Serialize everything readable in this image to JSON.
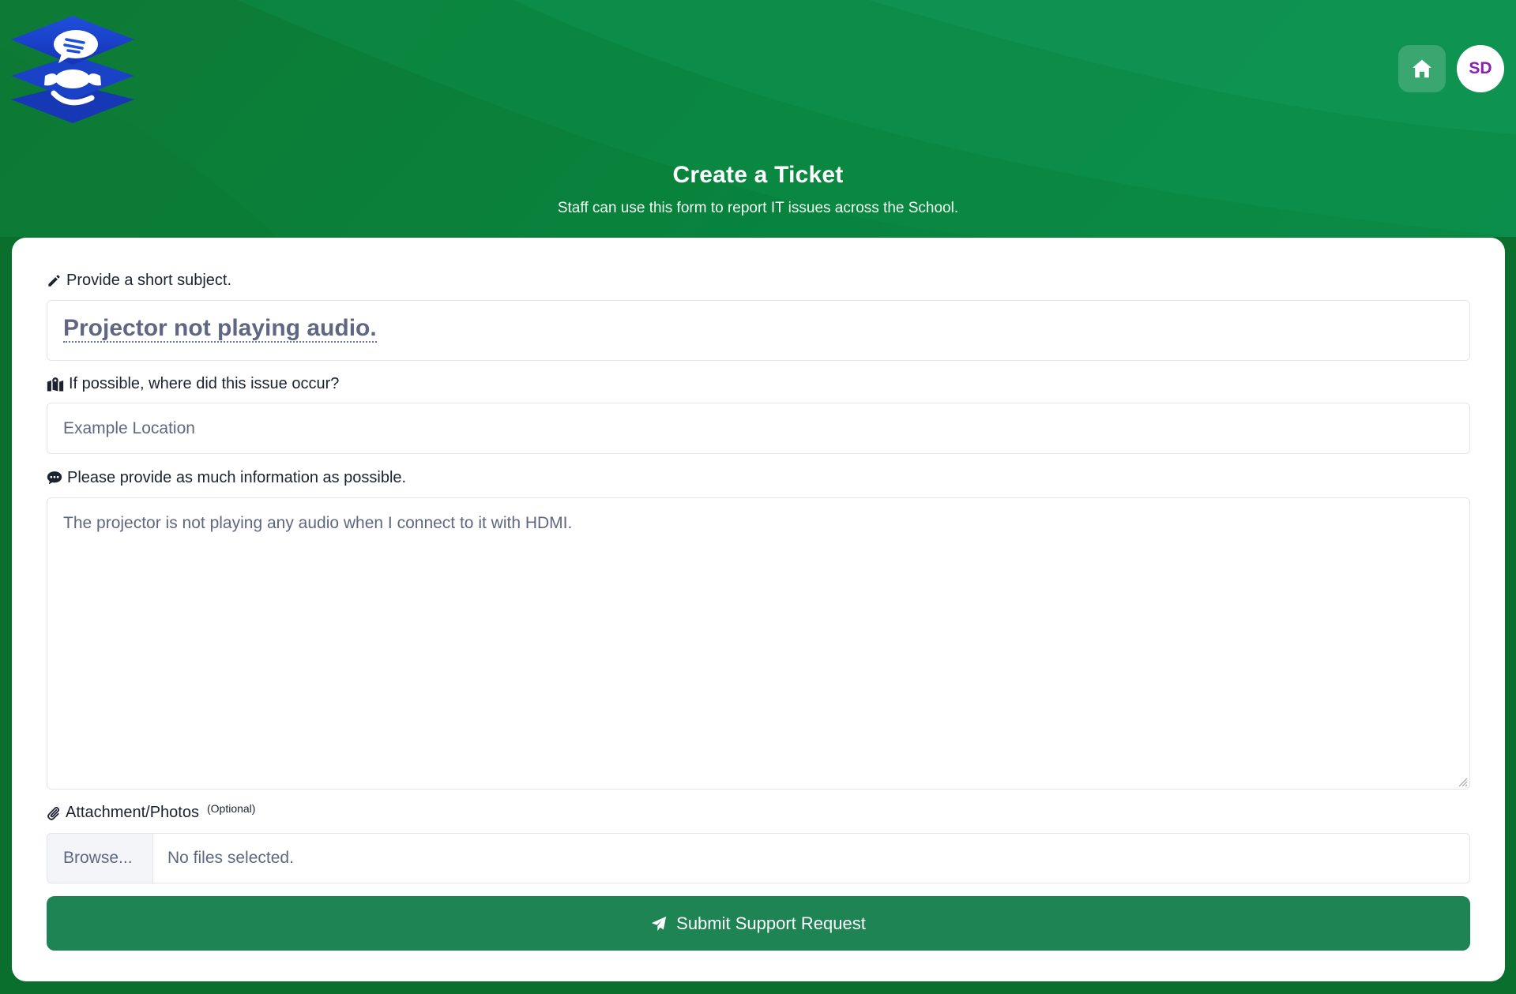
{
  "brand": {
    "bg_color": "#0a7a3a",
    "accent": "#1e8454",
    "avatar_text_color": "#8b1fb0"
  },
  "nav": {
    "home_icon": "home-icon",
    "avatar_initials": "SD"
  },
  "header": {
    "title": "Create a Ticket",
    "subtitle": "Staff can use this form to report IT issues across the School."
  },
  "form": {
    "subject": {
      "label": "Provide a short subject.",
      "icon": "pencil-icon",
      "value": "Projector not playing audio."
    },
    "location": {
      "label": "If possible, where did this issue occur?",
      "icon": "map-icon",
      "placeholder": "Example Location"
    },
    "description": {
      "label": "Please provide as much information as possible.",
      "icon": "comment-icon",
      "value": "The projector is not playing any audio when I connect to it with HDMI."
    },
    "attachment": {
      "label": "Attachment/Photos",
      "optional": "(Optional)",
      "icon": "paperclip-icon",
      "browse_label": "Browse...",
      "status": "No files selected."
    },
    "submit_label": "Submit Support Request",
    "submit_icon": "paper-plane-icon"
  }
}
